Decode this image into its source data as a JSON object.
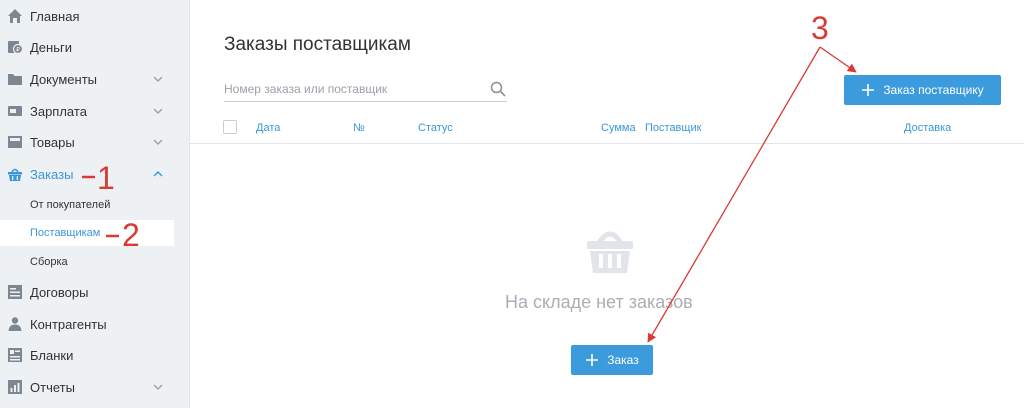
{
  "sidebar": {
    "items": [
      {
        "label": "Главная",
        "icon": "home-icon"
      },
      {
        "label": "Деньги",
        "icon": "money-icon"
      },
      {
        "label": "Документы",
        "icon": "documents-icon"
      },
      {
        "label": "Зарплата",
        "icon": "salary-icon"
      },
      {
        "label": "Товары",
        "icon": "goods-icon"
      },
      {
        "label": "Заказы",
        "icon": "basket-icon",
        "active": true
      },
      {
        "label": "Договоры",
        "icon": "contracts-icon"
      },
      {
        "label": "Контрагенты",
        "icon": "contractors-icon"
      },
      {
        "label": "Бланки",
        "icon": "forms-icon"
      },
      {
        "label": "Отчеты",
        "icon": "reports-icon"
      }
    ],
    "orders_sub": [
      {
        "label": "От покупателей"
      },
      {
        "label": "Поставщикам",
        "active": true
      },
      {
        "label": "Сборка"
      }
    ]
  },
  "main": {
    "title": "Заказы поставщикам",
    "search_placeholder": "Номер заказа или поставщик",
    "add_supplier_button": "Заказ поставщику",
    "columns": [
      "Дата",
      "№",
      "Статус",
      "Сумма",
      "Поставщик",
      "Доставка"
    ],
    "empty_text": "На складе нет заказов",
    "add_order_button": "Заказ"
  },
  "annotations": {
    "one": "1",
    "two": "2",
    "three": "3"
  },
  "colors": {
    "accent": "#3b9bdd",
    "annotation": "#d93a35",
    "sidebar_bg": "#eef1f4"
  }
}
